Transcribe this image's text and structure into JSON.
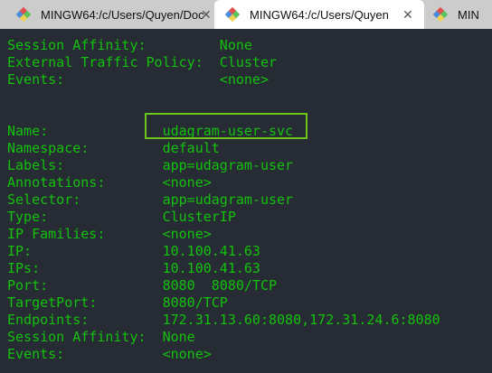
{
  "tabs": [
    {
      "title": "MINGW64:/c/Users/Quyen/Doc",
      "active": false
    },
    {
      "title": "MINGW64:/c/Users/Quyen",
      "active": true
    },
    {
      "title": "MIN",
      "active": false
    }
  ],
  "terminal": {
    "lines": [
      "Session Affinity:         None",
      "External Traffic Policy:  Cluster",
      "Events:                   <none>",
      "",
      "",
      "Name:              udagram-user-svc",
      "Namespace:         default",
      "Labels:            app=udagram-user",
      "Annotations:       <none>",
      "Selector:          app=udagram-user",
      "Type:              ClusterIP",
      "IP Families:       <none>",
      "IP:                10.100.41.63",
      "IPs:               10.100.41.63",
      "Port:              8080  8080/TCP",
      "TargetPort:        8080/TCP",
      "Endpoints:         172.31.13.60:8080,172.31.24.6:8080",
      "Session Affinity:  None",
      "Events:            <none>"
    ]
  },
  "colors": {
    "text": "#13c10e",
    "background": "#272b34",
    "highlight": "#6ac61b"
  }
}
